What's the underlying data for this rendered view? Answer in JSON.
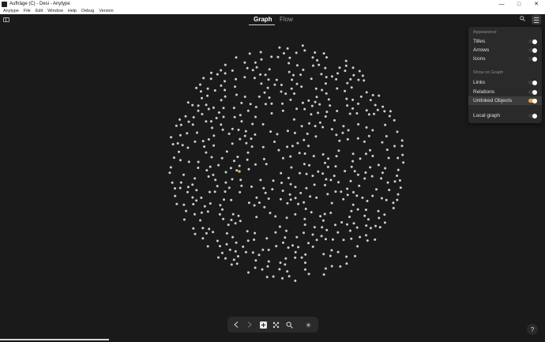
{
  "window": {
    "title": "Aufträge (C) - Desi - Anytype",
    "controls": [
      "—",
      "□",
      "✕"
    ]
  },
  "menu": [
    "Anytype",
    "File",
    "Edit",
    "Window",
    "Help",
    "Debug",
    "Version"
  ],
  "tabs": [
    {
      "label": "Graph",
      "active": true
    },
    {
      "label": "Flow",
      "active": false
    }
  ],
  "settings_panel": {
    "appearance_label": "Appearance",
    "appearance": [
      {
        "label": "Titles",
        "on": false
      },
      {
        "label": "Arrows",
        "on": false
      },
      {
        "label": "Icons",
        "on": false
      }
    ],
    "show_on_graph_label": "Show on Graph",
    "show_on_graph": [
      {
        "label": "Links",
        "on": false
      },
      {
        "label": "Relations",
        "on": false
      },
      {
        "label": "Unlinked Objects",
        "on": true
      }
    ],
    "local_graph": {
      "label": "Local graph",
      "on": false
    }
  },
  "graph": {
    "node_color": "#cfcfcf",
    "highlight_color": "#e0a54a",
    "accent_color": "#e0a54a"
  },
  "help_label": "?"
}
